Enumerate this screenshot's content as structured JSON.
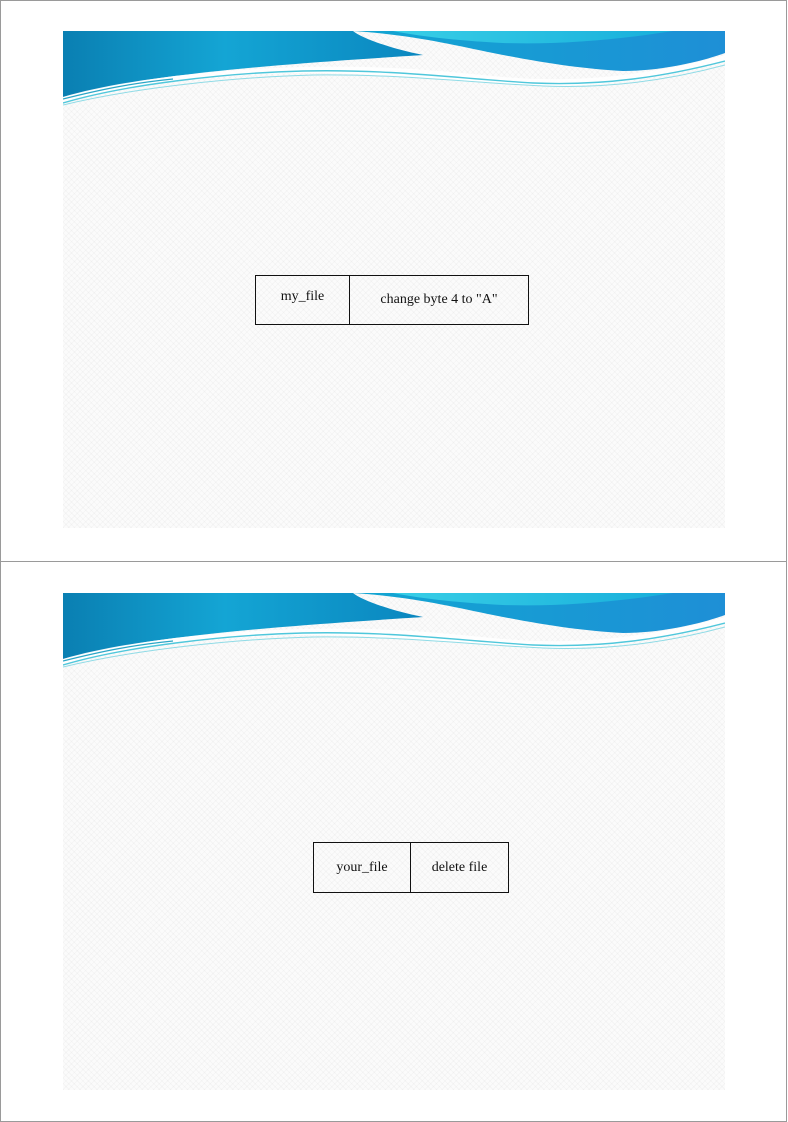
{
  "colors": {
    "banner_dark": "#0a7fb2",
    "banner_mid": "#15a9d6",
    "banner_light": "#34d0e6",
    "banner_wave": "#5fd5e3",
    "cell_border": "#111111"
  },
  "slides": [
    {
      "record": {
        "name": "my_file",
        "operation": "change byte 4 to \"A\""
      }
    },
    {
      "record": {
        "name": "your_file",
        "operation": "delete file"
      }
    }
  ]
}
